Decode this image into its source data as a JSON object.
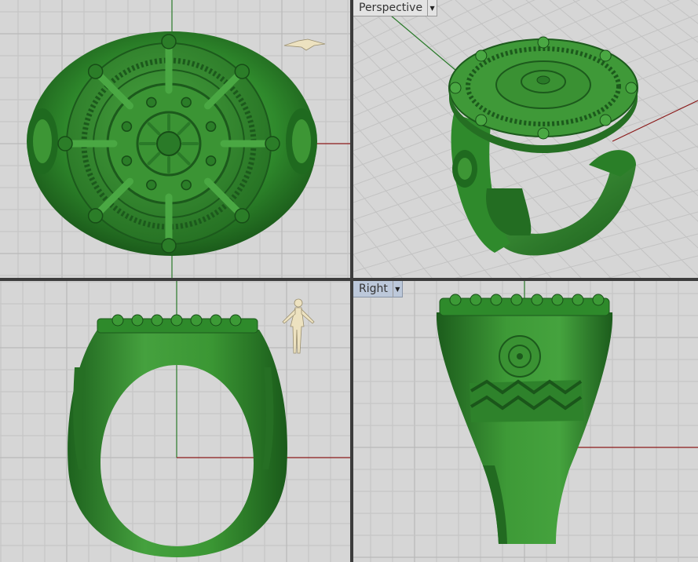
{
  "viewports": {
    "top": {
      "label": "",
      "view": "top"
    },
    "perspective": {
      "label": "Perspective",
      "dropdown_icon": "chevron-down-icon",
      "active": false
    },
    "front": {
      "label": "",
      "view": "front"
    },
    "right": {
      "label": "Right",
      "dropdown_icon": "chevron-down-icon",
      "active": true
    }
  },
  "colors": {
    "background": "#d6d6d6",
    "grid_minor": "#c3c3c3",
    "grid_major": "#b3b3b3",
    "axis_x": "#8b1a1a",
    "axis_y": "#2a7a2a",
    "model": "#2f8a2c",
    "model_dark": "#1c5a1c",
    "model_light": "#5cb04f",
    "active_label": "#bcc8da"
  },
  "icons": {
    "plane_icon": "airplane-scale-reference-icon",
    "human_icon": "human-scale-reference-icon"
  }
}
